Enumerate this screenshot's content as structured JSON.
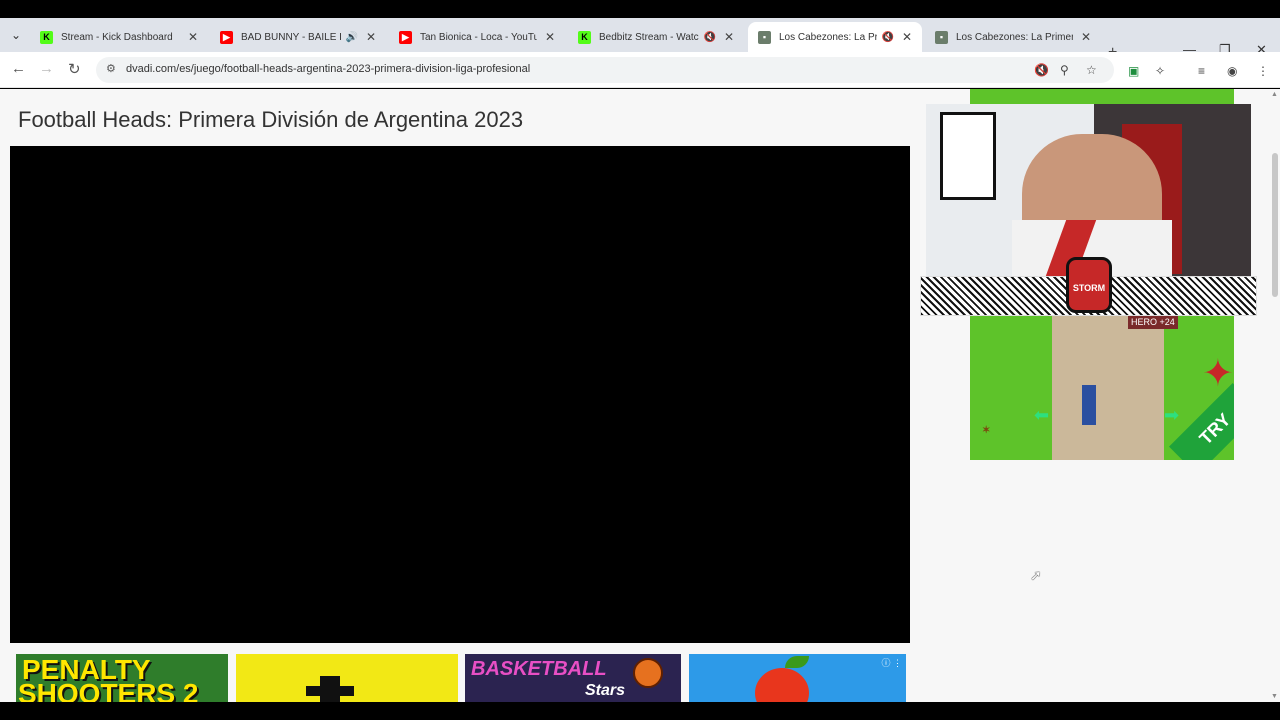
{
  "browser": {
    "tabs": [
      {
        "title": "Stream - Kick Dashboard",
        "icon": "kick-icon",
        "color": "#53fc18",
        "active": false
      },
      {
        "title": "BAD BUNNY - BAILE INo",
        "icon": "youtube-icon",
        "color": "#ff0000",
        "active": false
      },
      {
        "title": "Tan Bionica - Loca - YouTube",
        "icon": "youtube-icon",
        "color": "#ff0000",
        "active": false
      },
      {
        "title": "Bedbitz Stream - Watch",
        "icon": "kick-icon",
        "color": "#53fc18",
        "active": false
      },
      {
        "title": "Los Cabezones: La Prime",
        "icon": "site-icon",
        "color": "#6b7d6b",
        "active": true
      },
      {
        "title": "Los Cabezones: La Primera D",
        "icon": "site-icon",
        "color": "#6b7d6b",
        "active": false
      }
    ],
    "url": "dvadi.com/es/juego/football-heads-argentina-2023-primera-division-liga-profesional"
  },
  "page": {
    "title": "Football Heads: Primera División de Argentina 2023"
  },
  "thumbnails": {
    "penalty_line1": "PENALTY",
    "penalty_line2": "SHOOTERS 2",
    "basketball_line1": "BASKETBALL",
    "basketball_line2": "Stars"
  },
  "ad": {
    "try_label": "TRY",
    "hero_badge": "HERO +24"
  },
  "overlay": {
    "badge_text": "STORM"
  }
}
